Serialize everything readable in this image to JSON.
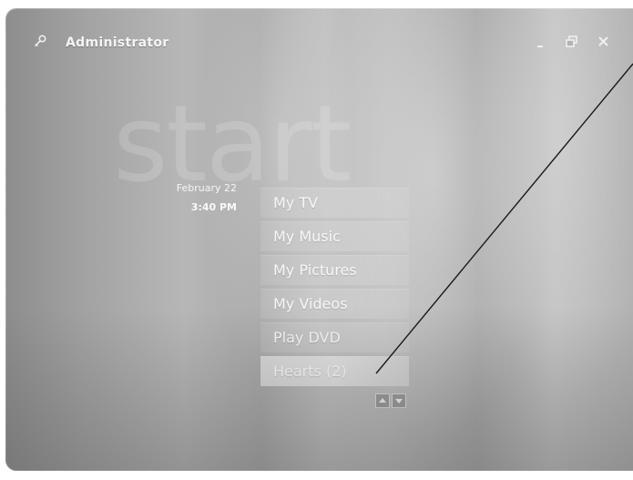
{
  "window": {
    "user_name": "Administrator",
    "icon": "key-icon",
    "controls": {
      "minimize": "minimize-icon",
      "restore": "restore-icon",
      "close": "close-icon"
    }
  },
  "watermark": "start",
  "clock": {
    "date": "February 22",
    "time": "3:40 PM"
  },
  "menu": {
    "items": [
      {
        "label": "My TV"
      },
      {
        "label": "My Music"
      },
      {
        "label": "My Pictures"
      },
      {
        "label": "My Videos"
      },
      {
        "label": "Play DVD"
      },
      {
        "label": "Hearts (2)",
        "selected": true
      }
    ]
  },
  "scroll": {
    "up_icon": "scroll-up-icon",
    "down_icon": "scroll-down-icon"
  }
}
